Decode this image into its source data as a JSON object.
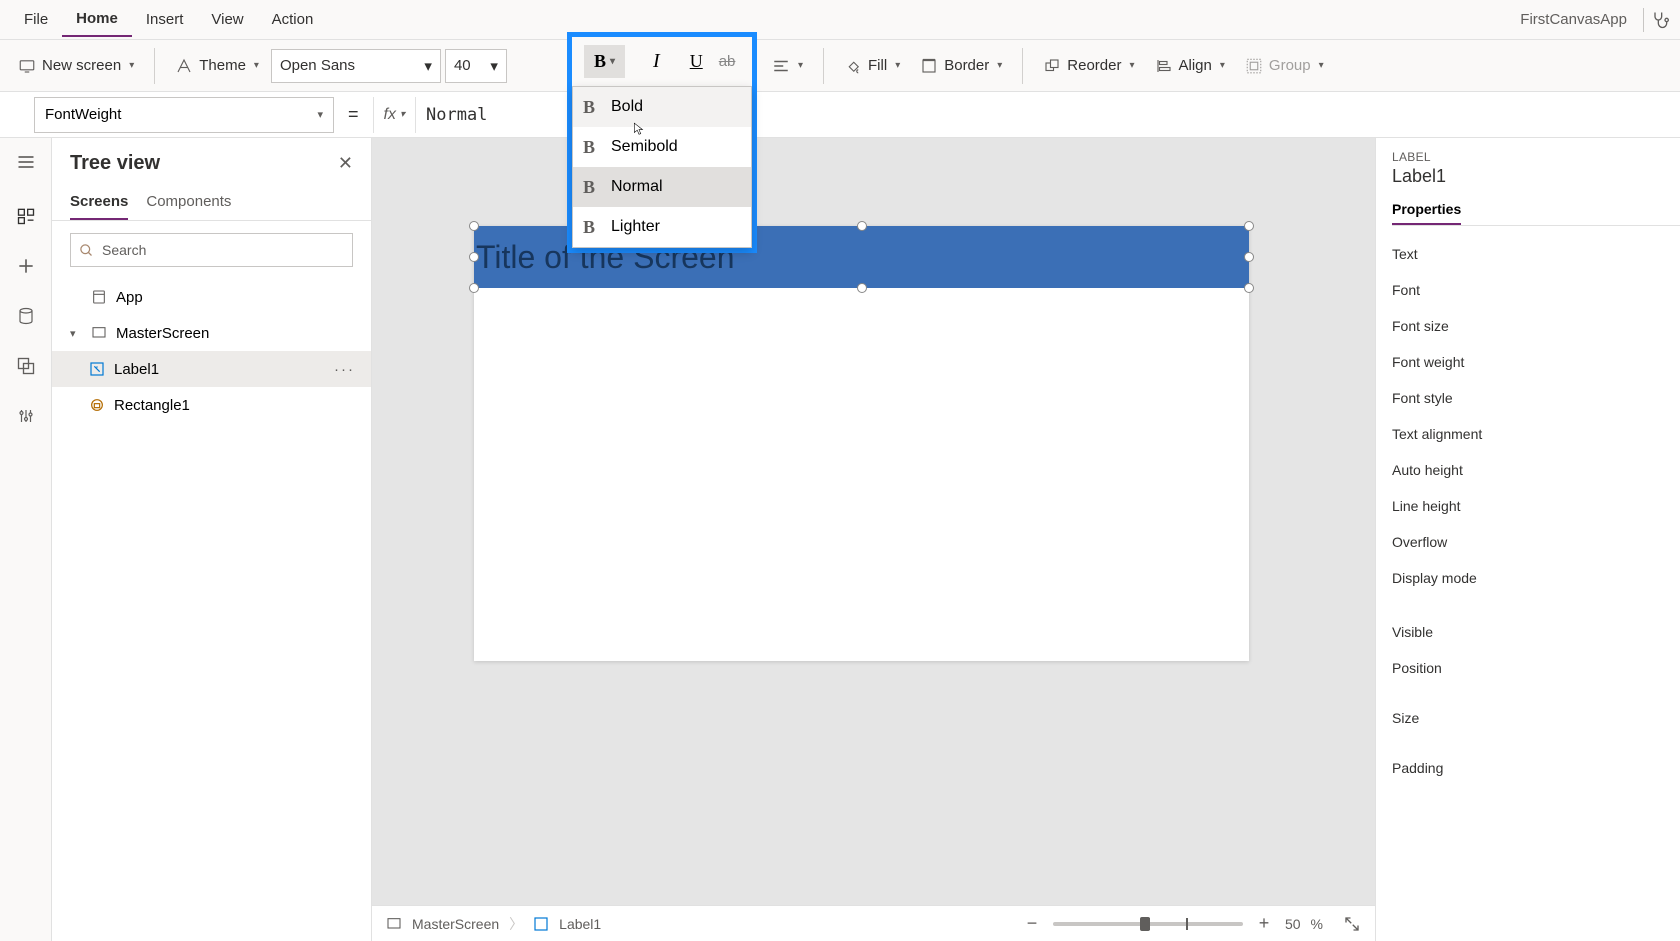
{
  "menu": {
    "file": "File",
    "home": "Home",
    "insert": "Insert",
    "view": "View",
    "action": "Action",
    "appName": "FirstCanvasApp"
  },
  "ribbon": {
    "newScreen": "New screen",
    "theme": "Theme",
    "font": "Open Sans",
    "fontSize": "40",
    "fill": "Fill",
    "border": "Border",
    "reorder": "Reorder",
    "align": "Align",
    "group": "Group"
  },
  "weightMenu": {
    "bold": "Bold",
    "semibold": "Semibold",
    "normal": "Normal",
    "lighter": "Lighter"
  },
  "formula": {
    "property": "FontWeight",
    "value": "Normal"
  },
  "tree": {
    "title": "Tree view",
    "tabScreens": "Screens",
    "tabComponents": "Components",
    "searchPlaceholder": "Search",
    "app": "App",
    "screen": "MasterScreen",
    "label": "Label1",
    "rect": "Rectangle1"
  },
  "canvas": {
    "titleText": "Title of the Screen"
  },
  "status": {
    "screen": "MasterScreen",
    "control": "Label1",
    "zoom": "50",
    "pct": "%"
  },
  "props": {
    "type": "LABEL",
    "name": "Label1",
    "tabProperties": "Properties",
    "rows": {
      "text": "Text",
      "font": "Font",
      "fontSize": "Font size",
      "fontWeight": "Font weight",
      "fontStyle": "Font style",
      "textAlign": "Text alignment",
      "autoHeight": "Auto height",
      "lineHeight": "Line height",
      "overflow": "Overflow",
      "displayMode": "Display mode",
      "visible": "Visible",
      "position": "Position",
      "size": "Size",
      "padding": "Padding"
    }
  }
}
